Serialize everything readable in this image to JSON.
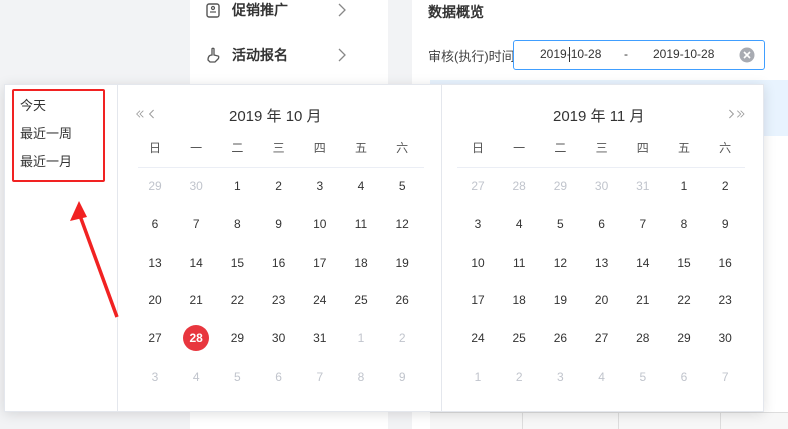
{
  "menu": {
    "items": [
      {
        "label": "促销推广",
        "icon": "tag-icon"
      },
      {
        "label": "活动报名",
        "icon": "hand-icon"
      }
    ]
  },
  "overview": {
    "title": "数据概览",
    "audit_label": "审核(执行)时间:",
    "start_date": "2019-10-28",
    "separator": "-",
    "end_date": "2019-10-28"
  },
  "shortcuts": [
    "今天",
    "最近一周",
    "最近一月"
  ],
  "weekdays": [
    "日",
    "一",
    "二",
    "三",
    "四",
    "五",
    "六"
  ],
  "calendar_left": {
    "title": "2019 年 10 月",
    "rows": [
      [
        "29",
        "30",
        "1",
        "2",
        "3",
        "4",
        "5"
      ],
      [
        "6",
        "7",
        "8",
        "9",
        "10",
        "11",
        "12"
      ],
      [
        "13",
        "14",
        "15",
        "16",
        "17",
        "18",
        "19"
      ],
      [
        "20",
        "21",
        "22",
        "23",
        "24",
        "25",
        "26"
      ],
      [
        "27",
        "28",
        "29",
        "30",
        "31",
        "1",
        "2"
      ],
      [
        "3",
        "4",
        "5",
        "6",
        "7",
        "8",
        "9"
      ]
    ],
    "muted": [
      [
        0,
        0
      ],
      [
        0,
        1
      ],
      [
        4,
        5
      ],
      [
        4,
        6
      ],
      [
        5,
        0
      ],
      [
        5,
        1
      ],
      [
        5,
        2
      ],
      [
        5,
        3
      ],
      [
        5,
        4
      ],
      [
        5,
        5
      ],
      [
        5,
        6
      ]
    ],
    "selected": [
      4,
      1
    ]
  },
  "calendar_right": {
    "title": "2019 年 11 月",
    "rows": [
      [
        "27",
        "28",
        "29",
        "30",
        "31",
        "1",
        "2"
      ],
      [
        "3",
        "4",
        "5",
        "6",
        "7",
        "8",
        "9"
      ],
      [
        "10",
        "11",
        "12",
        "13",
        "14",
        "15",
        "16"
      ],
      [
        "17",
        "18",
        "19",
        "20",
        "21",
        "22",
        "23"
      ],
      [
        "24",
        "25",
        "26",
        "27",
        "28",
        "29",
        "30"
      ],
      [
        "1",
        "2",
        "3",
        "4",
        "5",
        "6",
        "7"
      ]
    ],
    "muted": [
      [
        0,
        0
      ],
      [
        0,
        1
      ],
      [
        0,
        2
      ],
      [
        0,
        3
      ],
      [
        0,
        4
      ],
      [
        5,
        0
      ],
      [
        5,
        1
      ],
      [
        5,
        2
      ],
      [
        5,
        3
      ],
      [
        5,
        4
      ],
      [
        5,
        5
      ],
      [
        5,
        6
      ]
    ]
  },
  "colors": {
    "accent": "#409eff",
    "selected_day": "#e8363e",
    "annotation": "#f12222",
    "muted_day": "#c0c4cc"
  }
}
